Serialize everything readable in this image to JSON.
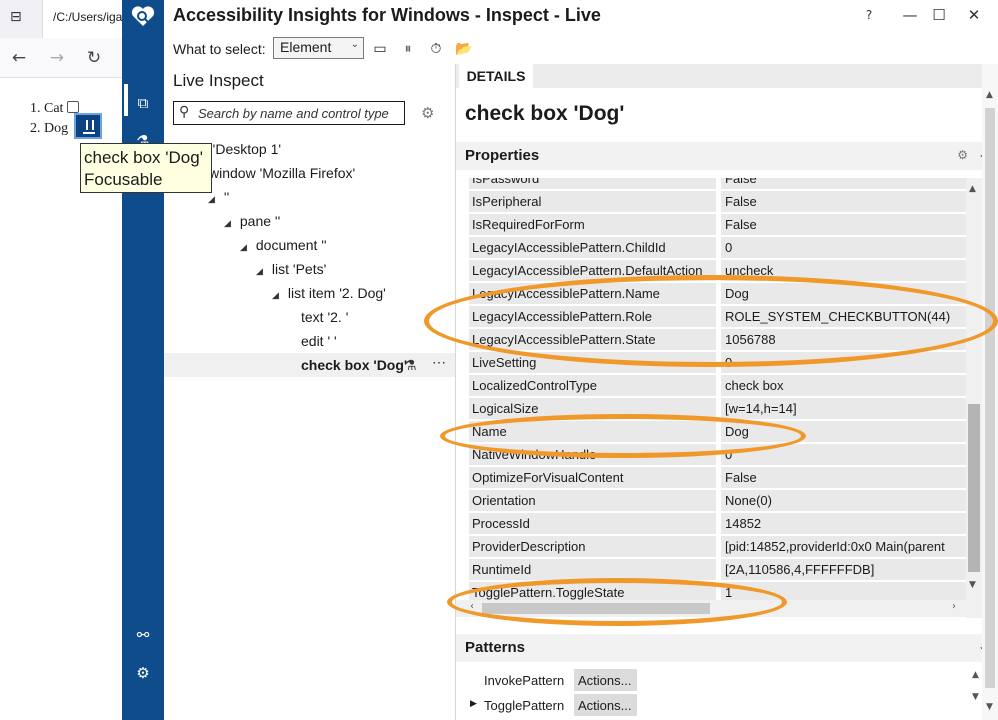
{
  "firefox": {
    "tab_title": "/C:/Users/iga",
    "list": [
      {
        "label": "1. Cat",
        "checked": false
      },
      {
        "label": "2. Dog",
        "checked": false
      }
    ],
    "tooltip": {
      "line1": "check box 'Dog'",
      "line2": "Focusable"
    }
  },
  "app": {
    "title": "Accessibility Insights for Windows - Inspect - Live",
    "toolbar": {
      "select_label": "What to select:",
      "select_value": "Element"
    },
    "live_inspect": {
      "title": "Live Inspect",
      "search_placeholder": "Search by name and control type",
      "tree": [
        {
          "label": "e 'Desktop 1'",
          "toggle": ""
        },
        {
          "label": "window 'Mozilla Firefox'",
          "toggle": ""
        },
        {
          "label": "''",
          "toggle": "◢"
        },
        {
          "label": "pane ''",
          "toggle": "◢"
        },
        {
          "label": "document ''",
          "toggle": "◢"
        },
        {
          "label": "list 'Pets'",
          "toggle": "◢"
        },
        {
          "label": "list item '2. Dog'",
          "toggle": "◢"
        },
        {
          "label": "text '2. '",
          "toggle": ""
        },
        {
          "label": "edit ' '",
          "toggle": ""
        },
        {
          "label": "check box 'Dog'",
          "toggle": "",
          "selected": true
        }
      ]
    },
    "details": {
      "tab": "DETAILS",
      "heading": "check box 'Dog'",
      "properties_title": "Properties",
      "properties": [
        {
          "name": "IsPassword",
          "value": "False"
        },
        {
          "name": "IsPeripheral",
          "value": "False"
        },
        {
          "name": "IsRequiredForForm",
          "value": "False"
        },
        {
          "name": "LegacyIAccessiblePattern.ChildId",
          "value": "0"
        },
        {
          "name": "LegacyIAccessiblePattern.DefaultAction",
          "value": "uncheck"
        },
        {
          "name": "LegacyIAccessiblePattern.Name",
          "value": "Dog"
        },
        {
          "name": "LegacyIAccessiblePattern.Role",
          "value": "ROLE_SYSTEM_CHECKBUTTON(44)"
        },
        {
          "name": "LegacyIAccessiblePattern.State",
          "value": "1056788"
        },
        {
          "name": "LiveSetting",
          "value": "0"
        },
        {
          "name": "LocalizedControlType",
          "value": "check box"
        },
        {
          "name": "LogicalSize",
          "value": "[w=14,h=14]"
        },
        {
          "name": "Name",
          "value": "Dog"
        },
        {
          "name": "NativeWindowHandle",
          "value": "0"
        },
        {
          "name": "OptimizeForVisualContent",
          "value": "False"
        },
        {
          "name": "Orientation",
          "value": "None(0)"
        },
        {
          "name": "ProcessId",
          "value": "14852"
        },
        {
          "name": "ProviderDescription",
          "value": "[pid:14852,providerId:0x0 Main(parent"
        },
        {
          "name": "RuntimeId",
          "value": "[2A,110586,4,FFFFFFDB]"
        },
        {
          "name": "TogglePattern.ToggleState",
          "value": "1"
        }
      ],
      "patterns_title": "Patterns",
      "patterns": [
        {
          "name": "InvokePattern",
          "action": "Actions...",
          "expand": ""
        },
        {
          "name": "TogglePattern",
          "action": "Actions...",
          "expand": "▶"
        }
      ]
    }
  },
  "colors": {
    "rail": "#0f4c8c",
    "annotation": "#f0982a",
    "tooltip_bg": "#ffffe1"
  }
}
